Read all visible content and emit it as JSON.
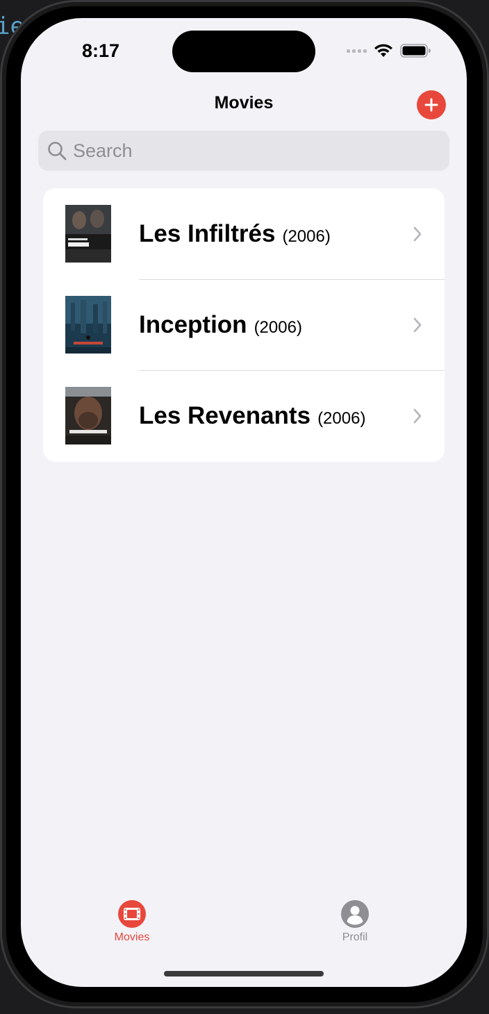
{
  "colors": {
    "accent": "#e8473c",
    "background": "#f2f2f7",
    "tab_inactive": "#8e8e93"
  },
  "status_bar": {
    "time": "8:17"
  },
  "nav": {
    "title": "Movies",
    "add_icon": "plus-circle-icon"
  },
  "search": {
    "placeholder": "Search",
    "icon": "magnifying-glass-icon"
  },
  "movies": [
    {
      "title": "Les Infiltrés",
      "year": "(2006)"
    },
    {
      "title": "Inception",
      "year": "(2006)"
    },
    {
      "title": "Les Revenants",
      "year": "(2006)"
    }
  ],
  "tabs": [
    {
      "label": "Movies",
      "icon": "film-icon",
      "selected": true
    },
    {
      "label": "Profil",
      "icon": "person-circle-icon",
      "selected": false
    }
  ]
}
